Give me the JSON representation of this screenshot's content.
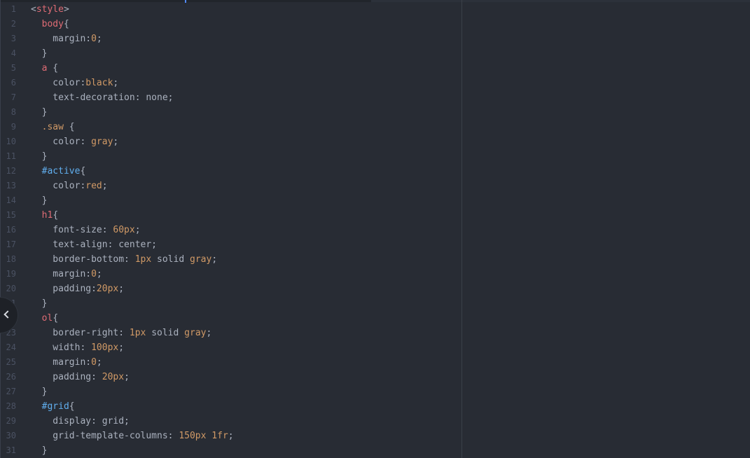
{
  "editor": {
    "line_numbers": [
      "1",
      "2",
      "3",
      "4",
      "5",
      "6",
      "7",
      "8",
      "9",
      "10",
      "11",
      "12",
      "13",
      "14",
      "15",
      "16",
      "17",
      "18",
      "19",
      "20",
      "21",
      "22",
      "23",
      "24",
      "25",
      "26",
      "27",
      "28",
      "29",
      "30",
      "31"
    ],
    "lines": [
      [
        {
          "t": "<",
          "c": "plain"
        },
        {
          "t": "style",
          "c": "tag"
        },
        {
          "t": ">",
          "c": "plain"
        }
      ],
      [
        {
          "t": "  "
        },
        {
          "t": "body",
          "c": "sel"
        },
        {
          "t": "{",
          "c": "plain"
        }
      ],
      [
        {
          "t": "    margin:",
          "c": "prop"
        },
        {
          "t": "0",
          "c": "val"
        },
        {
          "t": ";",
          "c": "plain"
        }
      ],
      [
        {
          "t": "  }",
          "c": "plain"
        }
      ],
      [
        {
          "t": "  "
        },
        {
          "t": "a",
          "c": "sel"
        },
        {
          "t": " {",
          "c": "plain"
        }
      ],
      [
        {
          "t": "    color:",
          "c": "prop"
        },
        {
          "t": "black",
          "c": "val"
        },
        {
          "t": ";",
          "c": "plain"
        }
      ],
      [
        {
          "t": "    text-decoration: none;",
          "c": "prop"
        }
      ],
      [
        {
          "t": "  }",
          "c": "plain"
        }
      ],
      [
        {
          "t": "  "
        },
        {
          "t": ".saw",
          "c": "class"
        },
        {
          "t": " {",
          "c": "plain"
        }
      ],
      [
        {
          "t": "    color: ",
          "c": "prop"
        },
        {
          "t": "gray",
          "c": "val"
        },
        {
          "t": ";",
          "c": "plain"
        }
      ],
      [
        {
          "t": "  }",
          "c": "plain"
        }
      ],
      [
        {
          "t": "  "
        },
        {
          "t": "#active",
          "c": "id"
        },
        {
          "t": "{",
          "c": "plain"
        }
      ],
      [
        {
          "t": "    color:",
          "c": "prop"
        },
        {
          "t": "red",
          "c": "val"
        },
        {
          "t": ";",
          "c": "plain"
        }
      ],
      [
        {
          "t": "  }",
          "c": "plain"
        }
      ],
      [
        {
          "t": "  "
        },
        {
          "t": "h1",
          "c": "sel"
        },
        {
          "t": "{",
          "c": "plain"
        }
      ],
      [
        {
          "t": "    font-size: ",
          "c": "prop"
        },
        {
          "t": "60px",
          "c": "val"
        },
        {
          "t": ";",
          "c": "plain"
        }
      ],
      [
        {
          "t": "    text-align: center;",
          "c": "prop"
        }
      ],
      [
        {
          "t": "    border-bottom: ",
          "c": "prop"
        },
        {
          "t": "1px",
          "c": "val"
        },
        {
          "t": " solid ",
          "c": "prop"
        },
        {
          "t": "gray",
          "c": "val"
        },
        {
          "t": ";",
          "c": "plain"
        }
      ],
      [
        {
          "t": "    margin:",
          "c": "prop"
        },
        {
          "t": "0",
          "c": "val"
        },
        {
          "t": ";",
          "c": "plain"
        }
      ],
      [
        {
          "t": "    padding:",
          "c": "prop"
        },
        {
          "t": "20px",
          "c": "val"
        },
        {
          "t": ";",
          "c": "plain"
        }
      ],
      [
        {
          "t": "  }",
          "c": "plain"
        }
      ],
      [
        {
          "t": "  "
        },
        {
          "t": "ol",
          "c": "sel"
        },
        {
          "t": "{",
          "c": "plain"
        }
      ],
      [
        {
          "t": "    border-right: ",
          "c": "prop"
        },
        {
          "t": "1px",
          "c": "val"
        },
        {
          "t": " solid ",
          "c": "prop"
        },
        {
          "t": "gray",
          "c": "val"
        },
        {
          "t": ";",
          "c": "plain"
        }
      ],
      [
        {
          "t": "    width: ",
          "c": "prop"
        },
        {
          "t": "100px",
          "c": "val"
        },
        {
          "t": ";",
          "c": "plain"
        }
      ],
      [
        {
          "t": "    margin:",
          "c": "prop"
        },
        {
          "t": "0",
          "c": "val"
        },
        {
          "t": ";",
          "c": "plain"
        }
      ],
      [
        {
          "t": "    padding: ",
          "c": "prop"
        },
        {
          "t": "20px",
          "c": "val"
        },
        {
          "t": ";",
          "c": "plain"
        }
      ],
      [
        {
          "t": "  }",
          "c": "plain"
        }
      ],
      [
        {
          "t": "  "
        },
        {
          "t": "#grid",
          "c": "id"
        },
        {
          "t": "{",
          "c": "plain"
        }
      ],
      [
        {
          "t": "    display: grid;",
          "c": "prop"
        }
      ],
      [
        {
          "t": "    grid-template-columns: ",
          "c": "prop"
        },
        {
          "t": "150px",
          "c": "val"
        },
        {
          "t": " ",
          "c": "plain"
        },
        {
          "t": "1fr",
          "c": "val"
        },
        {
          "t": ";",
          "c": "plain"
        }
      ],
      [
        {
          "t": "  }",
          "c": "plain"
        }
      ]
    ]
  },
  "icons": {
    "collapse": "chevron-left-icon"
  },
  "colors": {
    "background": "#282c34",
    "tag": "#e06c75",
    "id": "#61afef",
    "value": "#d19a66",
    "text": "#abb2bf",
    "line_number": "#4b5263"
  }
}
